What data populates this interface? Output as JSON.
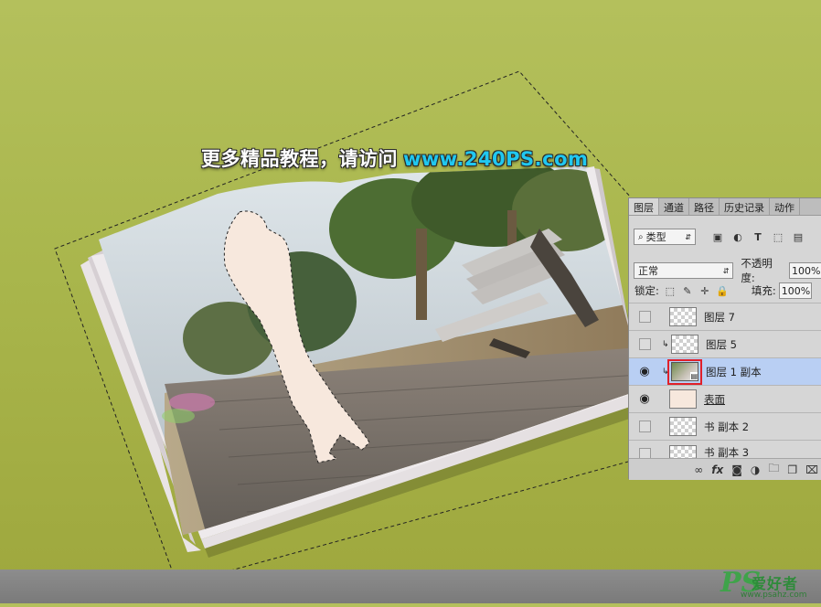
{
  "banner": {
    "text_cn": "更多精品教程，请访问",
    "url": "www.240PS.com"
  },
  "panel": {
    "tabs": [
      "图层",
      "通道",
      "路径",
      "历史记录",
      "动作"
    ],
    "filter": {
      "icon": "search-icon",
      "label": "类型"
    },
    "blend_mode": "正常",
    "opacity_label": "不透明度:",
    "opacity_value": "100%",
    "lock_label": "锁定:",
    "fill_label": "填充:",
    "fill_value": "100%",
    "layers": [
      {
        "name": "图层 7",
        "visible": false,
        "clipped": false,
        "selected": false
      },
      {
        "name": "图层 5",
        "visible": false,
        "clipped": true,
        "selected": false
      },
      {
        "name": "图层 1 副本",
        "visible": true,
        "clipped": true,
        "selected": true
      },
      {
        "name": "表面",
        "visible": true,
        "clipped": false,
        "selected": false
      },
      {
        "name": "书 副本 2",
        "visible": false,
        "clipped": false,
        "selected": false
      },
      {
        "name": "书 副本 3",
        "visible": false,
        "clipped": false,
        "selected": false
      }
    ],
    "footer_fx": "fx"
  },
  "watermark": {
    "logo": "PS",
    "cn": "爱好者",
    "url": "www.psahz.com"
  },
  "colors": {
    "background": "#a9b64c",
    "selected_layer": "#b9cff3",
    "highlight": "#e0202a"
  }
}
